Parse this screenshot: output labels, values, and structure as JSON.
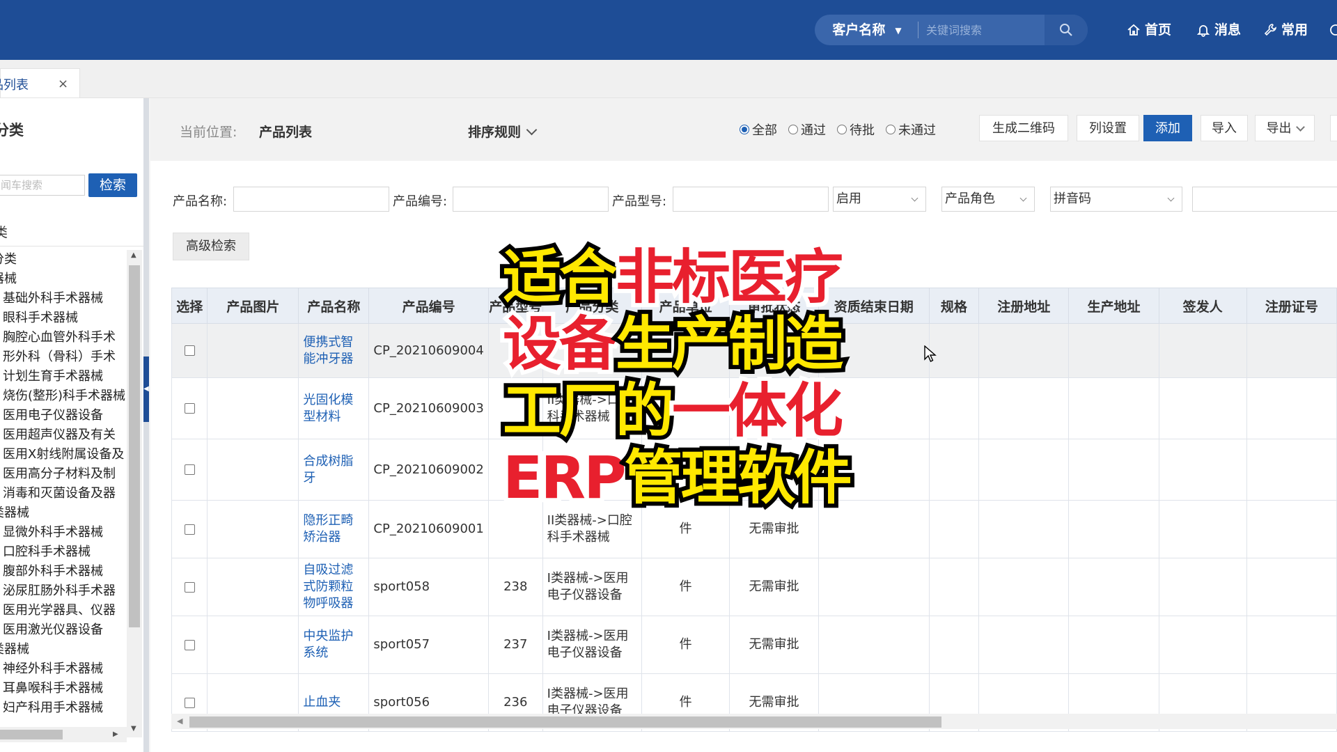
{
  "header": {
    "search_type": "客户名称",
    "search_placeholder": "关键词搜索",
    "nav": [
      {
        "label": "首页"
      },
      {
        "label": "消息"
      },
      {
        "label": "常用"
      }
    ]
  },
  "tab": {
    "label": "品列表",
    "close": "×"
  },
  "sidebar": {
    "title": "分类",
    "search_placeholder": "闻车搜索",
    "search_button": "检索",
    "section": "类",
    "tree": [
      {
        "label": "分类",
        "level": 0
      },
      {
        "label": "器械",
        "level": 0
      },
      {
        "label": "基础外科手术器械",
        "level": 1
      },
      {
        "label": "眼科手术器械",
        "level": 1
      },
      {
        "label": "胸腔心血管外科手术",
        "level": 1
      },
      {
        "label": "形外科（骨科）手术",
        "level": 1
      },
      {
        "label": "计划生育手术器械",
        "level": 1
      },
      {
        "label": "烧伤(整形)科手术器械",
        "level": 1
      },
      {
        "label": "医用电子仪器设备",
        "level": 1
      },
      {
        "label": "医用超声仪器及有关",
        "level": 1
      },
      {
        "label": "医用X射线附属设备及",
        "level": 1
      },
      {
        "label": "医用高分子材料及制",
        "level": 1
      },
      {
        "label": "消毒和灭菌设备及器",
        "level": 1
      },
      {
        "label": "类器械",
        "level": 0
      },
      {
        "label": "显微外科手术器械",
        "level": 1
      },
      {
        "label": "口腔科手术器械",
        "level": 1
      },
      {
        "label": "腹部外科手术器械",
        "level": 1
      },
      {
        "label": "泌尿肛肠外科手术器",
        "level": 1
      },
      {
        "label": "医用光学器具、仪器",
        "level": 1
      },
      {
        "label": "医用激光仪器设备",
        "level": 1
      },
      {
        "label": "类器械",
        "level": 0
      },
      {
        "label": "神经外科手术器械",
        "level": 1
      },
      {
        "label": "耳鼻喉科手术器械",
        "level": 1
      },
      {
        "label": "妇产科用手术器械",
        "level": 1
      }
    ]
  },
  "toolbar": {
    "location_label": "当前位置:",
    "location_value": "产品列表",
    "sort_label": "排序规则",
    "radios": [
      {
        "label": "全部",
        "checked": true
      },
      {
        "label": "通过",
        "checked": false
      },
      {
        "label": "待批",
        "checked": false
      },
      {
        "label": "未通过",
        "checked": false
      }
    ],
    "btn_qrcode": "生成二维码",
    "btn_columns": "列设置",
    "btn_add": "添加",
    "btn_import": "导入",
    "btn_export": "导出"
  },
  "filters": {
    "product_name_label": "产品名称:",
    "product_code_label": "产品编号:",
    "product_model_label": "产品型号:",
    "status_select": "启用",
    "role_select": "产品角色",
    "pinyin_select": "拼音码",
    "advanced_button": "高级检索"
  },
  "table": {
    "headers": [
      "选择",
      "产品图片",
      "产品名称",
      "产品编号",
      "产品型号",
      "产品分类",
      "产品单位",
      "审批状态",
      "资质结束日期",
      "规格",
      "注册地址",
      "生产地址",
      "签发人",
      "注册证号"
    ],
    "rows": [
      {
        "name": "便携式智能冲牙器",
        "code": "CP_20210609004",
        "model": "",
        "category": "",
        "unit": "",
        "status": ""
      },
      {
        "name": "光固化模型材料",
        "code": "CP_20210609003",
        "model": "",
        "category": "II类器械->口腔科手术器械",
        "unit": "",
        "status": ""
      },
      {
        "name": "合成树脂牙",
        "code": "CP_20210609002",
        "model": "",
        "category": "",
        "unit": "",
        "status": ""
      },
      {
        "name": "隐形正畸矫治器",
        "code": "CP_20210609001",
        "model": "",
        "category": "II类器械->口腔科手术器械",
        "unit": "件",
        "status": "无需审批"
      },
      {
        "name": "自吸过滤式防颗粒物呼吸器",
        "code": "sport058",
        "model": "238",
        "category": "I类器械->医用电子仪器设备",
        "unit": "件",
        "status": "无需审批"
      },
      {
        "name": "中央监护系统",
        "code": "sport057",
        "model": "237",
        "category": "I类器械->医用电子仪器设备",
        "unit": "件",
        "status": "无需审批"
      },
      {
        "name": "止血夹",
        "code": "sport056",
        "model": "236",
        "category": "I类器械->医用电子仪器设备",
        "unit": "件",
        "status": "无需审批"
      }
    ]
  },
  "overlay": {
    "segments": [
      [
        {
          "text": "适合",
          "color": "yellow"
        },
        {
          "text": "非标医疗",
          "color": "red"
        }
      ],
      [
        {
          "text": "设备",
          "color": "red"
        },
        {
          "text": "生产制造",
          "color": "yellow"
        }
      ],
      [
        {
          "text": "工厂的",
          "color": "yellow"
        },
        {
          "text": "一体化",
          "color": "red"
        }
      ],
      [
        {
          "text": "ERP",
          "color": "red"
        },
        {
          "text": "管理软件",
          "color": "yellow"
        }
      ]
    ]
  },
  "colors": {
    "header_bg": "#1e4d96",
    "primary": "#1e60b4",
    "link": "#1e60b4",
    "overlay_yellow": "#ffe800",
    "overlay_red": "#e8202e"
  }
}
